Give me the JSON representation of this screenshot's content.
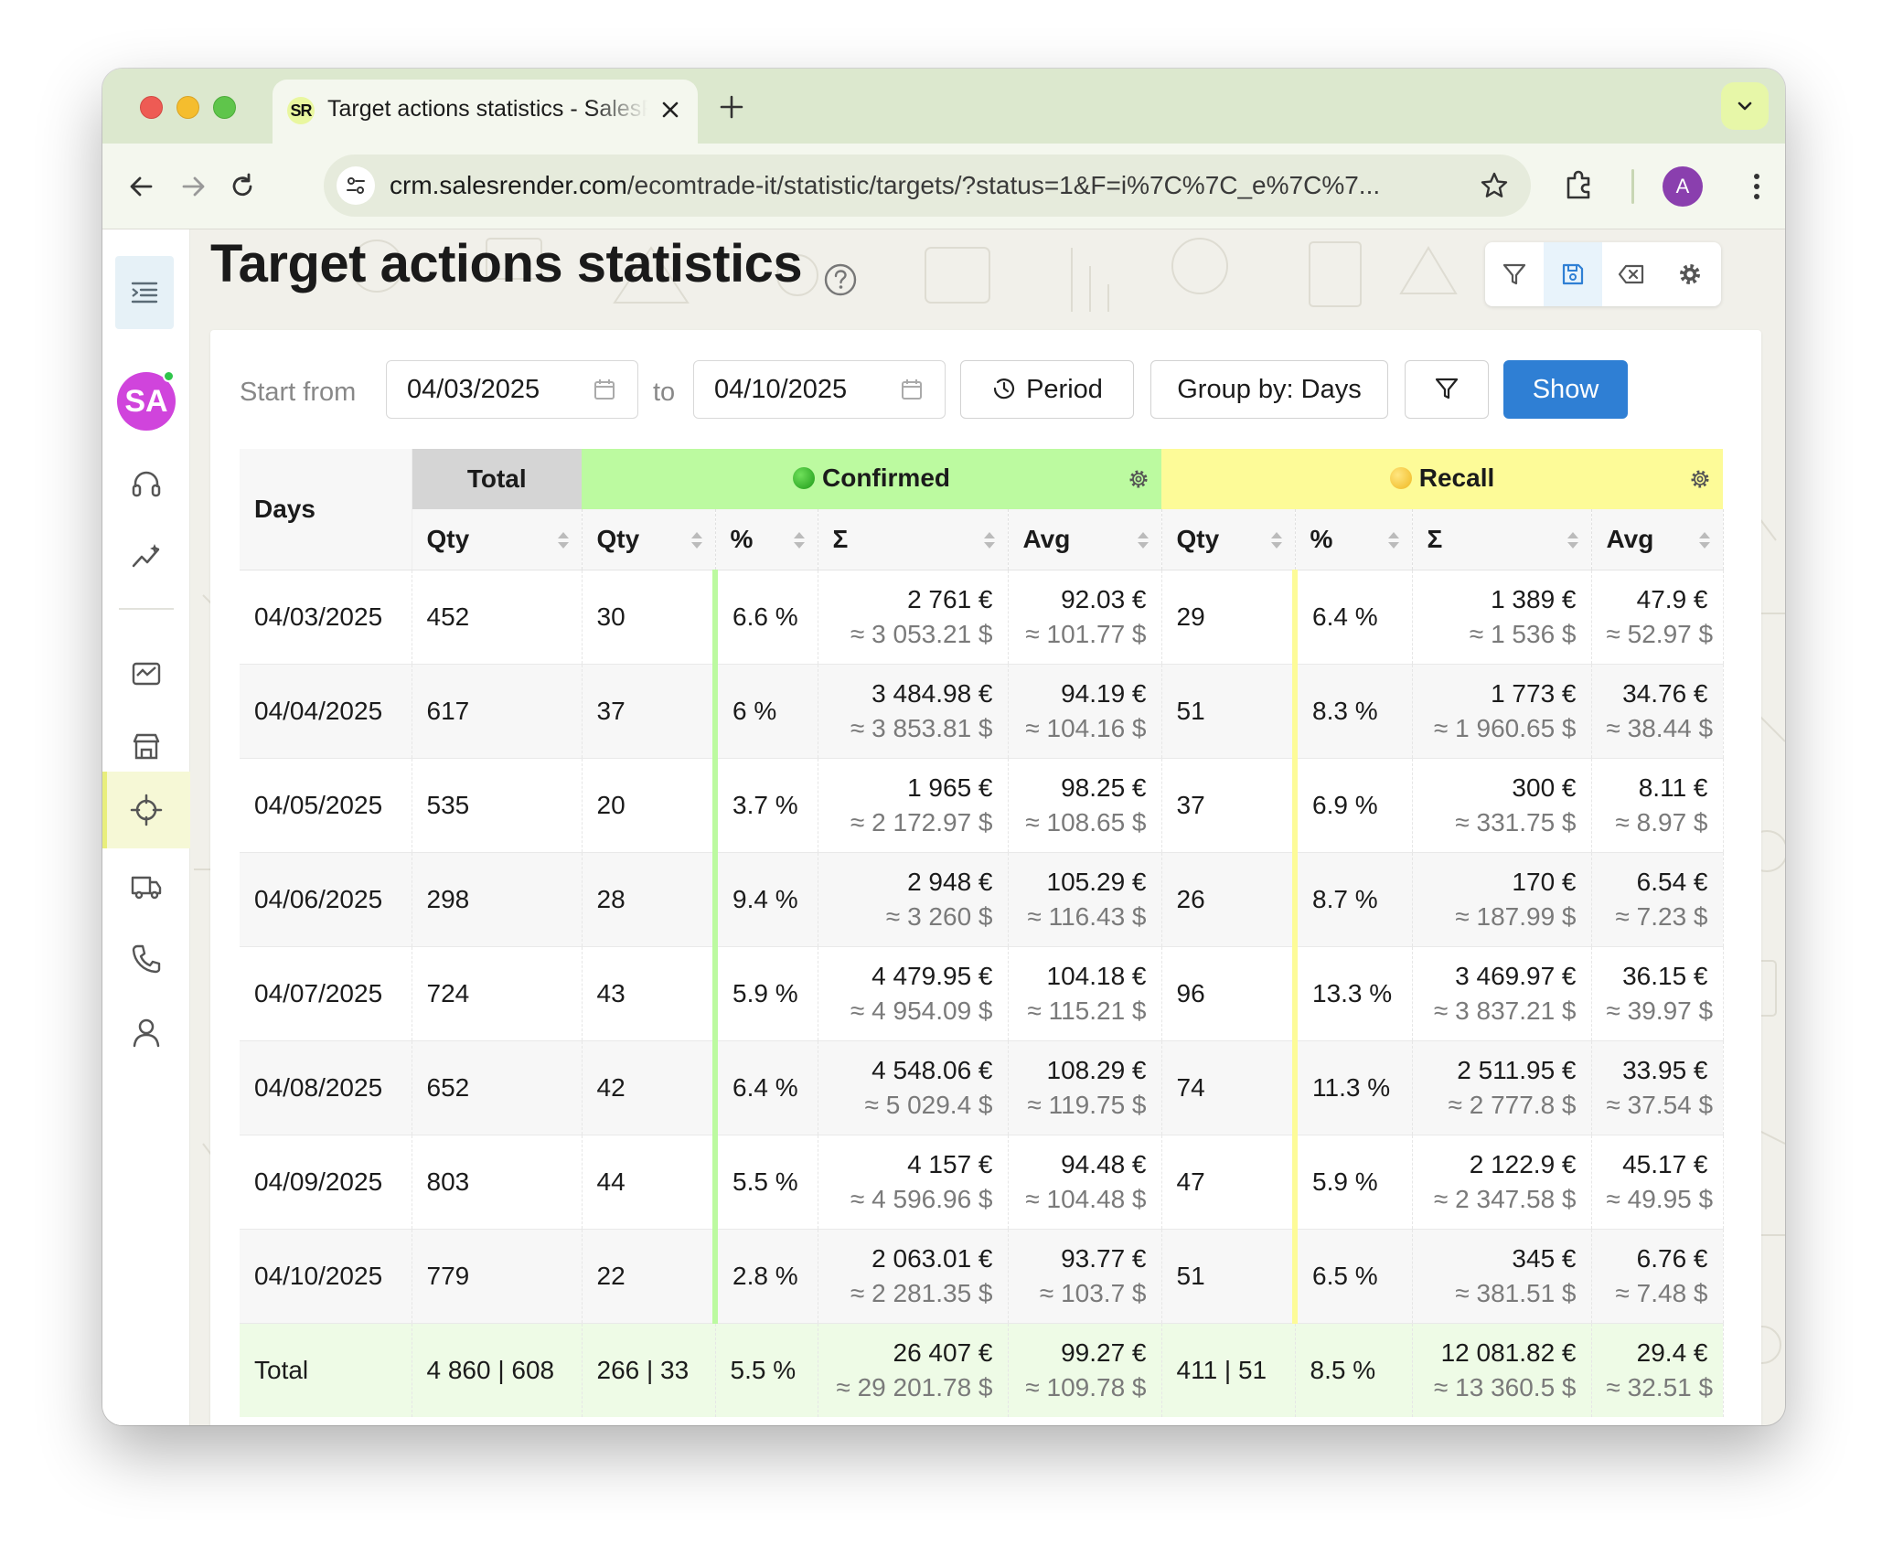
{
  "browser": {
    "tab_logo": "SR",
    "tab_title": "Target actions statistics - SalesRender",
    "url_host": "crm.salesrender.com",
    "url_path": "/ecomtrade-it/statistic/targets/?status=1&F=i%7C%7C_e%7C%7...",
    "profile_initial": "A"
  },
  "sidebar": {
    "avatar_initials": "SA",
    "icons": [
      "menu-collapse-icon",
      "headset-icon",
      "analytics-icon",
      "statistics-icon",
      "store-icon",
      "target-icon",
      "delivery-truck-icon",
      "phone-icon",
      "user-icon"
    ],
    "active_item": "target-icon"
  },
  "page": {
    "title": "Target actions statistics"
  },
  "filters": {
    "start_label": "Start from",
    "start_date": "04/03/2025",
    "to_label": "to",
    "end_date": "04/10/2025",
    "period_label": "Period",
    "group_by_label": "Group by: Days",
    "show_label": "Show"
  },
  "table": {
    "days_header": "Days",
    "total_header": "Total",
    "confirmed_header": "Confirmed",
    "recall_header": "Recall",
    "col_qty": "Qty",
    "col_pct": "%",
    "col_sum": "Σ",
    "col_avg": "Avg",
    "colors": {
      "confirmed": "#bcfaa0",
      "recall": "#fdfb98",
      "weekend_date": "#e02b2b",
      "total_row": "#eefbe6"
    },
    "rows": [
      {
        "day": "04/03/2025",
        "total": "452",
        "c_qty": "30",
        "c_pct": "6.6 %",
        "c_sum": "2 761 €",
        "c_sum_usd": "≈ 3 053.21 $",
        "c_avg": "92.03 €",
        "c_avg_usd": "≈ 101.77 $",
        "r_qty": "29",
        "r_pct": "6.4 %",
        "r_sum": "1 389 €",
        "r_sum_usd": "≈ 1 536 $",
        "r_avg": "47.9 €",
        "r_avg_usd": "≈ 52.97 $"
      },
      {
        "day": "04/04/2025",
        "total": "617",
        "c_qty": "37",
        "c_pct": "6 %",
        "c_sum": "3 484.98 €",
        "c_sum_usd": "≈ 3 853.81 $",
        "c_avg": "94.19 €",
        "c_avg_usd": "≈ 104.16 $",
        "r_qty": "51",
        "r_pct": "8.3 %",
        "r_sum": "1 773 €",
        "r_sum_usd": "≈ 1 960.65 $",
        "r_avg": "34.76 €",
        "r_avg_usd": "≈ 38.44 $"
      },
      {
        "day": "04/05/2025",
        "total": "535",
        "c_qty": "20",
        "c_pct": "3.7 %",
        "c_sum": "1 965 €",
        "c_sum_usd": "≈ 2 172.97 $",
        "c_avg": "98.25 €",
        "c_avg_usd": "≈ 108.65 $",
        "r_qty": "37",
        "r_pct": "6.9 %",
        "r_sum": "300 €",
        "r_sum_usd": "≈ 331.75 $",
        "r_avg": "8.11 €",
        "r_avg_usd": "≈ 8.97 $"
      },
      {
        "day": "04/06/2025",
        "total": "298",
        "c_qty": "28",
        "c_pct": "9.4 %",
        "c_sum": "2 948 €",
        "c_sum_usd": "≈ 3 260 $",
        "c_avg": "105.29 €",
        "c_avg_usd": "≈ 116.43 $",
        "r_qty": "26",
        "r_pct": "8.7 %",
        "r_sum": "170 €",
        "r_sum_usd": "≈ 187.99 $",
        "r_avg": "6.54 €",
        "r_avg_usd": "≈ 7.23 $"
      },
      {
        "day": "04/07/2025",
        "total": "724",
        "c_qty": "43",
        "c_pct": "5.9 %",
        "c_sum": "4 479.95 €",
        "c_sum_usd": "≈ 4 954.09 $",
        "c_avg": "104.18 €",
        "c_avg_usd": "≈ 115.21 $",
        "r_qty": "96",
        "r_pct": "13.3 %",
        "r_sum": "3 469.97 €",
        "r_sum_usd": "≈ 3 837.21 $",
        "r_avg": "36.15 €",
        "r_avg_usd": "≈ 39.97 $"
      },
      {
        "day": "04/08/2025",
        "total": "652",
        "c_qty": "42",
        "c_pct": "6.4 %",
        "c_sum": "4 548.06 €",
        "c_sum_usd": "≈ 5 029.4 $",
        "c_avg": "108.29 €",
        "c_avg_usd": "≈ 119.75 $",
        "r_qty": "74",
        "r_pct": "11.3 %",
        "r_sum": "2 511.95 €",
        "r_sum_usd": "≈ 2 777.8 $",
        "r_avg": "33.95 €",
        "r_avg_usd": "≈ 37.54 $"
      },
      {
        "day": "04/09/2025",
        "total": "803",
        "c_qty": "44",
        "c_pct": "5.5 %",
        "c_sum": "4 157 €",
        "c_sum_usd": "≈ 4 596.96 $",
        "c_avg": "94.48 €",
        "c_avg_usd": "≈ 104.48 $",
        "r_qty": "47",
        "r_pct": "5.9 %",
        "r_sum": "2 122.9 €",
        "r_sum_usd": "≈ 2 347.58 $",
        "r_avg": "45.17 €",
        "r_avg_usd": "≈ 49.95 $"
      },
      {
        "day": "04/10/2025",
        "total": "779",
        "c_qty": "22",
        "c_pct": "2.8 %",
        "c_sum": "2 063.01 €",
        "c_sum_usd": "≈ 2 281.35 $",
        "c_avg": "93.77 €",
        "c_avg_usd": "≈ 103.7 $",
        "r_qty": "51",
        "r_pct": "6.5 %",
        "r_sum": "345 €",
        "r_sum_usd": "≈ 381.51 $",
        "r_avg": "6.76 €",
        "r_avg_usd": "≈ 7.48 $"
      }
    ],
    "totals": {
      "label": "Total",
      "total": "4 860 | 608",
      "c_qty": "266 | 33",
      "c_pct": "5.5 %",
      "c_sum": "26 407 €",
      "c_sum_usd": "≈ 29 201.78 $",
      "c_avg": "99.27 €",
      "c_avg_usd": "≈ 109.78 $",
      "r_qty": "411 | 51",
      "r_pct": "8.5 %",
      "r_sum": "12 081.82 €",
      "r_sum_usd": "≈ 13 360.5 $",
      "r_avg": "29.4 €",
      "r_avg_usd": "≈ 32.51 $"
    }
  }
}
